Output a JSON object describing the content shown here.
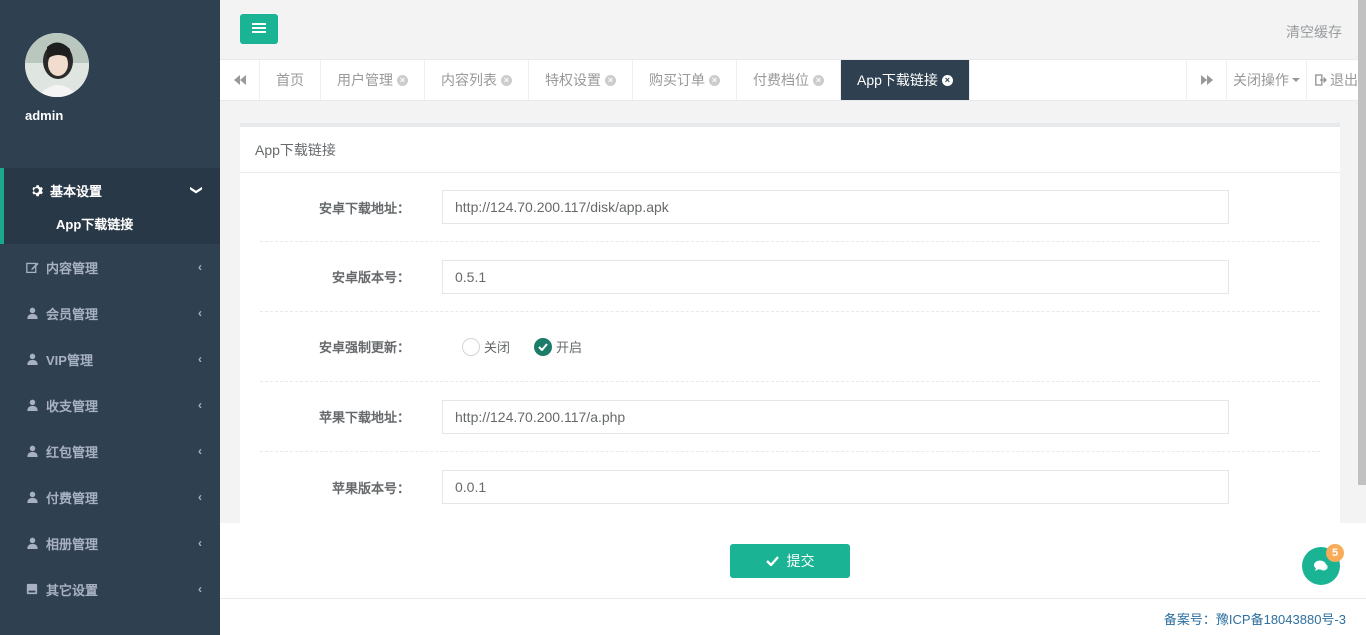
{
  "profile": {
    "name": "admin"
  },
  "topbar": {
    "clear_cache": "清空缓存"
  },
  "sidebar": {
    "active_group": {
      "label": "基本设置",
      "icon": "gear-icon",
      "sub": "App下载链接"
    },
    "items": [
      {
        "label": "内容管理",
        "icon": "edit-icon"
      },
      {
        "label": "会员管理",
        "icon": "user-icon"
      },
      {
        "label": "VIP管理",
        "icon": "user-icon"
      },
      {
        "label": "收支管理",
        "icon": "user-icon"
      },
      {
        "label": "红包管理",
        "icon": "user-icon"
      },
      {
        "label": "付费管理",
        "icon": "user-icon"
      },
      {
        "label": "相册管理",
        "icon": "user-icon"
      },
      {
        "label": "其它设置",
        "icon": "book-icon"
      }
    ]
  },
  "tabs": {
    "items": [
      "首页",
      "用户管理",
      "内容列表",
      "特权设置",
      "购买订单",
      "付费档位",
      "App下载链接"
    ],
    "active": "App下载链接",
    "ops": "关闭操作",
    "logout": "退出"
  },
  "panel": {
    "title": "App下载链接"
  },
  "form": {
    "android_url_label": "安卓下载地址：",
    "android_url_value": "http://124.70.200.117/disk/app.apk",
    "android_version_label": "安卓版本号：",
    "android_version_value": "0.5.1",
    "android_force_label": "安卓强制更新：",
    "force_off": "关闭",
    "force_on": "开启",
    "force_selected": "开启",
    "ios_url_label": "苹果下载地址：",
    "ios_url_value": "http://124.70.200.117/a.php",
    "ios_version_label": "苹果版本号：",
    "ios_version_value": "0.0.1"
  },
  "submit": {
    "label": "提交"
  },
  "footer": {
    "icp": "备案号：豫ICP备18043880号-3"
  },
  "chat": {
    "badge": "5"
  },
  "colors": {
    "accent": "#1ab394",
    "sidebar": "#2f4050",
    "badge": "#f8ac59"
  }
}
